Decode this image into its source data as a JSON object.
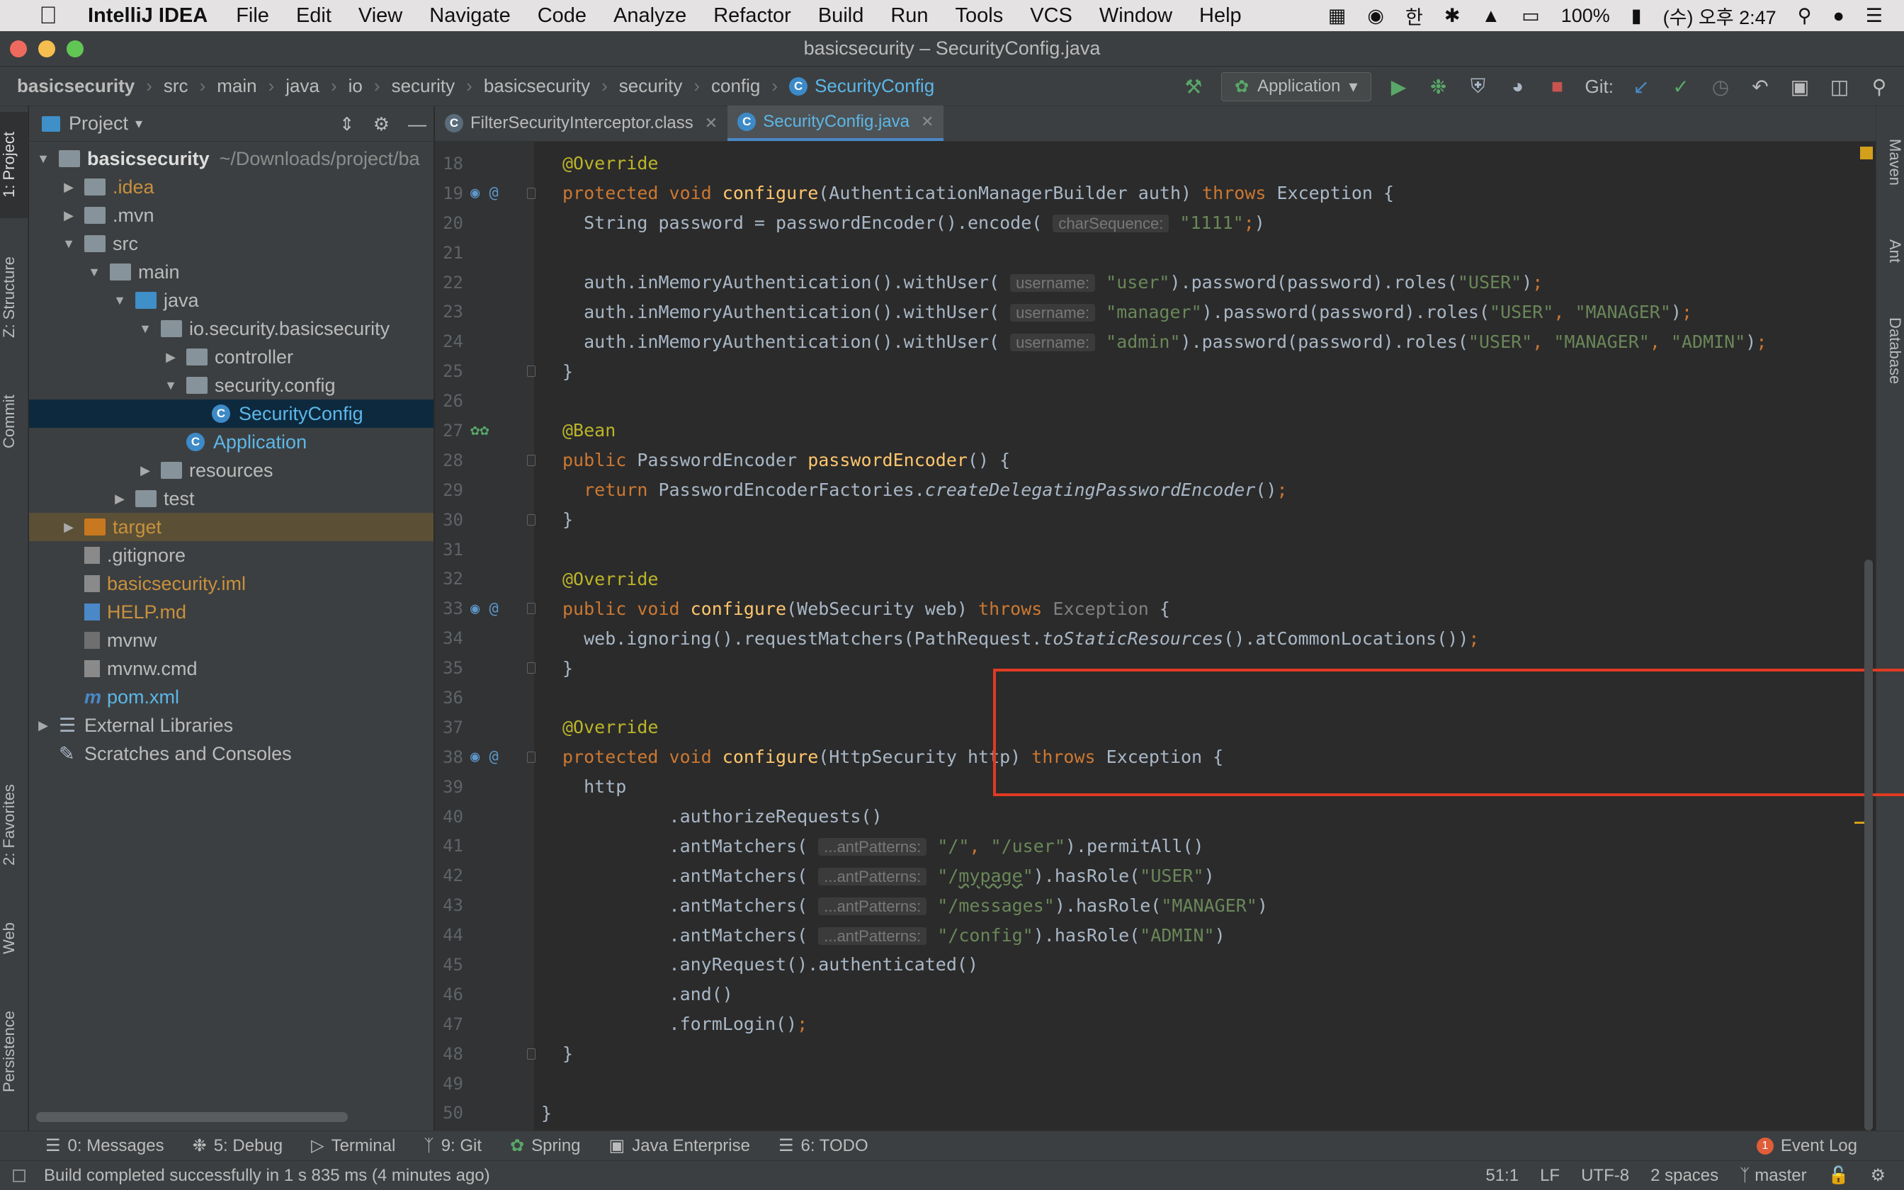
{
  "menubar": {
    "app_name": "IntelliJ IDEA",
    "items": [
      "File",
      "Edit",
      "View",
      "Navigate",
      "Code",
      "Analyze",
      "Refactor",
      "Build",
      "Run",
      "Tools",
      "VCS",
      "Window",
      "Help"
    ],
    "battery": "100%",
    "clock": "(수) 오후 2:47",
    "input_method": "한"
  },
  "window": {
    "title": "basicsecurity – SecurityConfig.java"
  },
  "breadcrumbs": [
    "basicsecurity",
    "src",
    "main",
    "java",
    "io",
    "security",
    "basicsecurity",
    "security",
    "config"
  ],
  "breadcrumb_file": "SecurityConfig",
  "toolbar": {
    "run_config": "Application",
    "git_label": "Git:"
  },
  "left_tabs": [
    "1: Project",
    "Z: Structure",
    "Commit",
    "2: Favorites",
    "Web",
    "Persistence"
  ],
  "right_tabs": [
    "Maven",
    "Ant",
    "Database"
  ],
  "project_panel": {
    "title": "Project",
    "root": "basicsecurity",
    "root_path": "~/Downloads/project/ba",
    "items": {
      "idea": ".idea",
      "mvn": ".mvn",
      "src": "src",
      "main": "main",
      "java": "java",
      "pkg": "io.security.basicsecurity",
      "controller": "controller",
      "security_config": "security.config",
      "security_config_class": "SecurityConfig",
      "application": "Application",
      "resources": "resources",
      "test": "test",
      "target": "target",
      "gitignore": ".gitignore",
      "iml": "basicsecurity.iml",
      "help": "HELP.md",
      "mvnw": "mvnw",
      "mvnw_cmd": "mvnw.cmd",
      "pom": "pom.xml",
      "external": "External Libraries",
      "scratches": "Scratches and Consoles"
    }
  },
  "editor": {
    "tabs": [
      {
        "label": "FilterSecurityInterceptor.class"
      },
      {
        "label": "SecurityConfig.java"
      }
    ]
  },
  "tool_windows": {
    "messages": "0: Messages",
    "debug": "5: Debug",
    "terminal": "Terminal",
    "git": "9: Git",
    "spring": "Spring",
    "java_enterprise": "Java Enterprise",
    "todo": "6: TODO",
    "event_log": "Event Log",
    "event_count": "1"
  },
  "status": {
    "message": "Build completed successfully in 1 s 835 ms (4 minutes ago)",
    "position": "51:1",
    "line_sep": "LF",
    "encoding": "UTF-8",
    "indent": "2 spaces",
    "branch": "master"
  },
  "colors": {
    "accent": "#4a88c7",
    "highlight_box": "#e03b22",
    "keyword": "#cc7832",
    "string": "#6a8759",
    "annotation": "#bbb529"
  }
}
